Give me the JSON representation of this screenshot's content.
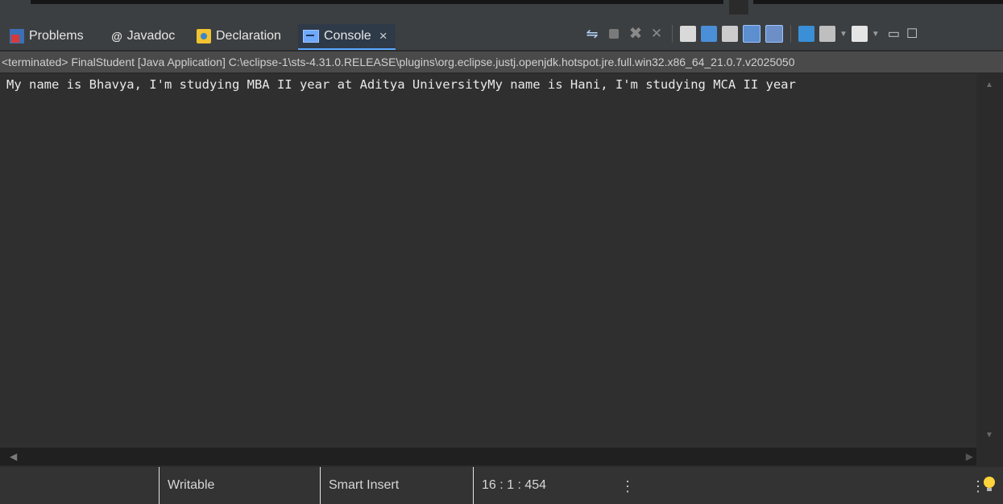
{
  "tabs": [
    {
      "label": "Problems",
      "icon": "problems-icon"
    },
    {
      "label": "Javadoc",
      "icon": "javadoc-icon"
    },
    {
      "label": "Declaration",
      "icon": "declaration-icon"
    },
    {
      "label": "Console",
      "icon": "console-icon",
      "active": true,
      "close": "×"
    }
  ],
  "path": "<terminated> FinalStudent [Java Application] C:\\eclipse-1\\sts-4.31.0.RELEASE\\plugins\\org.eclipse.justj.openjdk.hotspot.jre.full.win32.x86_64_21.0.7.v2025050",
  "console_output": "My name is Bhavya, I'm studying MBA II year at Aditya UniversityMy name is Hani, I'm studying MCA II year",
  "status": {
    "writable": "Writable",
    "insert_mode": "Smart Insert",
    "position": "16 : 1 : 454"
  },
  "colors": {
    "accent": "#5aa9ff",
    "background": "#2b2b2b"
  }
}
